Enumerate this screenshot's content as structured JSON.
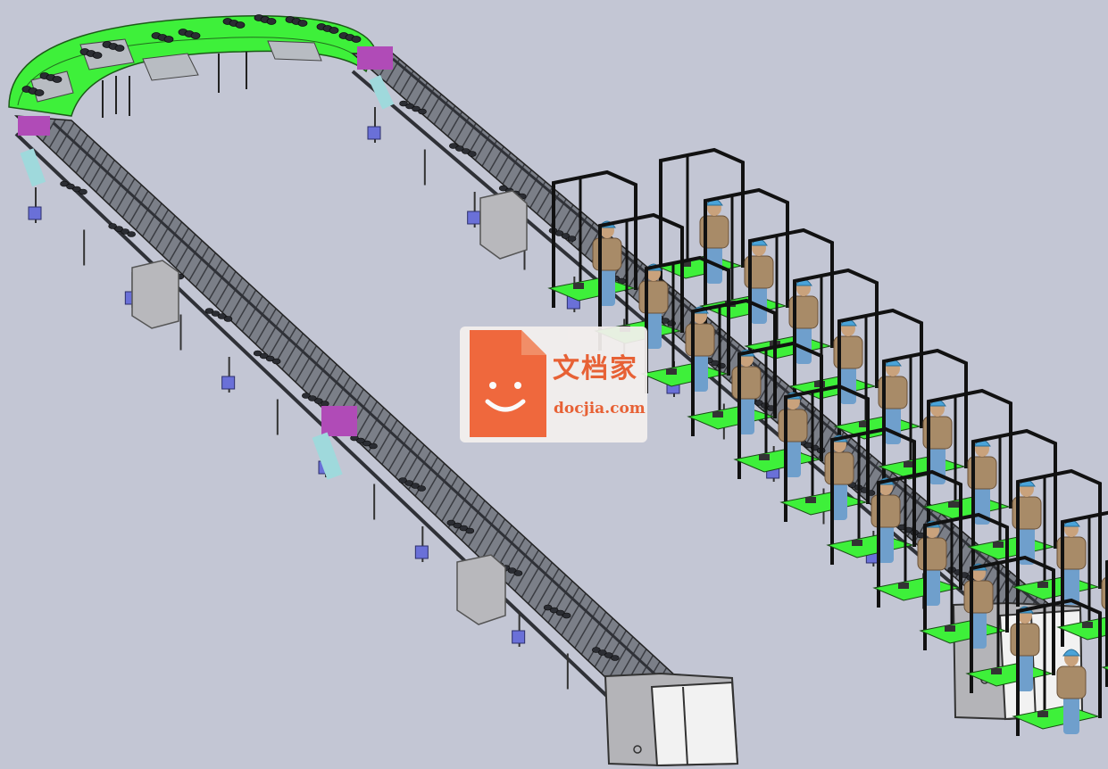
{
  "scene": {
    "subject": "assembly-line-with-workstations",
    "colors": {
      "background": "#c3c6d4",
      "conveyor_green": "#3ef03a",
      "frame_black": "#111111",
      "cabinet_gray": "#b5b5b5",
      "motor_blue": "#6a70d8",
      "worker_shirt": "#a88b68",
      "worker_jeans": "#6f9fcc",
      "helmet": "#4aa3d8"
    },
    "worker_count": 22
  },
  "watermark": {
    "brand_cn": "文档家",
    "domain": "docjia.com",
    "colors": {
      "logo": "#f36132",
      "text": "#ea5a2a"
    }
  }
}
